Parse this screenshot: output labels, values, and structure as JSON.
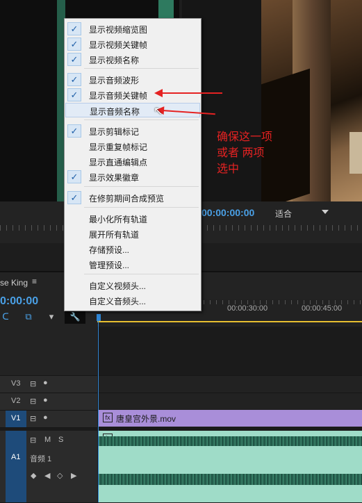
{
  "source_monitor": {},
  "program_monitor": {
    "timecode": "00:00:00:00",
    "fit_select": "适合"
  },
  "timeline": {
    "sequence_name": "se King",
    "menu_glyph": "≡",
    "timecode": "0:00:00",
    "ruler_times": [
      "00:00:30:00",
      "00:00:45:00"
    ],
    "tracks": {
      "v3": "V3",
      "v2": "V2",
      "v1": "V1",
      "a1": "A1",
      "a1_name": "音频 1",
      "v1_src": "V1",
      "a1_src": "A1",
      "mute": "M",
      "solo": "S"
    },
    "clip_video_name": "唐皇宫外景.mov",
    "fx_badge": "fx"
  },
  "context_menu": {
    "items": [
      {
        "label": "显示视频缩览图",
        "checked": true
      },
      {
        "label": "显示视频关键帧",
        "checked": true
      },
      {
        "label": "显示视频名称",
        "checked": true
      },
      {
        "label": "显示音频波形",
        "checked": true
      },
      {
        "label": "显示音频关键帧",
        "checked": true
      },
      {
        "label": "显示音频名称",
        "checked": false
      },
      {
        "label": "显示剪辑标记",
        "checked": true
      },
      {
        "label": "显示重复帧标记",
        "checked": false
      },
      {
        "label": "显示直通编辑点",
        "checked": false
      },
      {
        "label": "显示效果徽章",
        "checked": true
      },
      {
        "label": "在修剪期间合成预览",
        "checked": true
      },
      {
        "label": "最小化所有轨道",
        "checked": false
      },
      {
        "label": "展开所有轨道",
        "checked": false
      },
      {
        "label": "存储预设...",
        "checked": false
      },
      {
        "label": "管理预设...",
        "checked": false
      },
      {
        "label": "自定义视频头...",
        "checked": false
      },
      {
        "label": "自定义音频头...",
        "checked": false
      }
    ],
    "check_glyph": "✓"
  },
  "annotation": {
    "line1": "确保这一项",
    "line2": "或者 两项",
    "line3": "选中",
    "color": "#e52222"
  },
  "colors": {
    "accent": "#4aa0e6",
    "clip_video": "#a98ed9",
    "clip_audio": "#9fdcc8",
    "track_target": "#1e4b7a"
  }
}
